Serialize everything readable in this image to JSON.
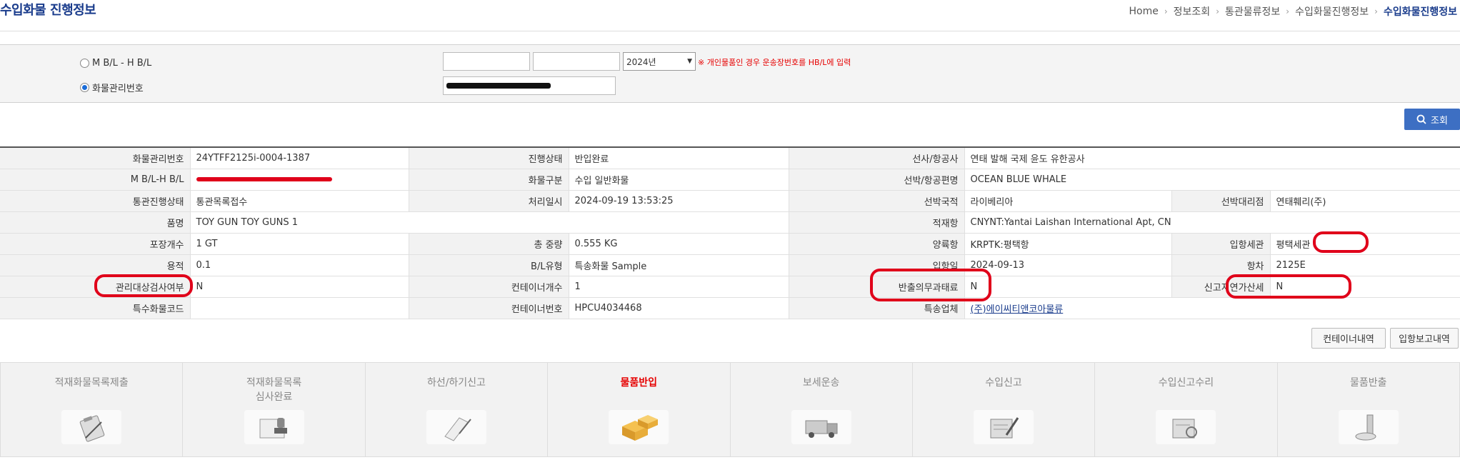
{
  "header": {
    "title": "수입화물 진행정보",
    "breadcrumb": [
      "Home",
      "정보조회",
      "통관물류정보",
      "수입화물진행정보",
      "수입화물진행정보"
    ]
  },
  "search": {
    "radio_bl_label": "M B/L - H B/L",
    "radio_cargo_label": "화물관리번호",
    "mbl_value": "",
    "hbl_value": "",
    "year_select": "2024년",
    "note": "※ 개인물품인 경우 운송장번호를 HB/L에 입력",
    "cargo_no_value": "",
    "search_button": "조회",
    "selected": "화물관리번호"
  },
  "info": {
    "rows": [
      [
        [
          "화물관리번호",
          "24YTFF2125i-0004-1387"
        ],
        [
          "진행상태",
          "반입완료"
        ],
        [
          "선사/항공사",
          "연태 발해 국제 윤도 유한공사"
        ]
      ],
      [
        [
          "M B/L-H B/L",
          ""
        ],
        [
          "화물구분",
          "수입 일반화물"
        ],
        [
          "선박/항공편명",
          "OCEAN BLUE WHALE"
        ]
      ],
      [
        [
          "통관진행상태",
          "통관목록접수"
        ],
        [
          "처리일시",
          "2024-09-19 13:53:25"
        ],
        [
          "선박국적",
          "라이베리아"
        ],
        [
          "선박대리점",
          "연태훼리(주)"
        ]
      ],
      [
        [
          "품명",
          "TOY GUN TOY GUNS 1"
        ],
        [
          "적재항",
          "CNYNT:Yantai Laishan International Apt, CN"
        ]
      ],
      [
        [
          "포장개수",
          "1 GT"
        ],
        [
          "총 중량",
          "0.555 KG"
        ],
        [
          "양륙항",
          "KRPTK:평택항"
        ],
        [
          "입항세관",
          "평택세관"
        ]
      ],
      [
        [
          "용적",
          "0.1"
        ],
        [
          "B/L유형",
          "특송화물 Sample"
        ],
        [
          "입항일",
          "2024-09-13"
        ],
        [
          "항차",
          "2125E"
        ]
      ],
      [
        [
          "관리대상검사여부",
          "N"
        ],
        [
          "컨테이너개수",
          "1"
        ],
        [
          "반출의무과태료",
          "N"
        ],
        [
          "신고지연가산세",
          "N"
        ]
      ],
      [
        [
          "특수화물코드",
          ""
        ],
        [
          "컨테이너번호",
          "HPCU4034468"
        ],
        [
          "특송업체",
          "(주)에이씨티앤코아물류"
        ]
      ]
    ]
  },
  "buttons": {
    "container_list": "컨테이너내역",
    "entry_report": "입항보고내역"
  },
  "steps": [
    {
      "label": "적재화물목록제출",
      "icon": "clipboard-icon",
      "active": false
    },
    {
      "label": "적재화물목록\n심사완료",
      "icon": "stamp-icon",
      "active": false
    },
    {
      "label": "하선/하기신고",
      "icon": "notebook-icon",
      "active": false
    },
    {
      "label": "물품반입",
      "icon": "boxes-icon",
      "active": true
    },
    {
      "label": "보세운송",
      "icon": "truck-icon",
      "active": false
    },
    {
      "label": "수입신고",
      "icon": "form-pen-icon",
      "active": false
    },
    {
      "label": "수입신고수리",
      "icon": "form-stamp-icon",
      "active": false
    },
    {
      "label": "물품반출",
      "icon": "release-icon",
      "active": false
    }
  ]
}
